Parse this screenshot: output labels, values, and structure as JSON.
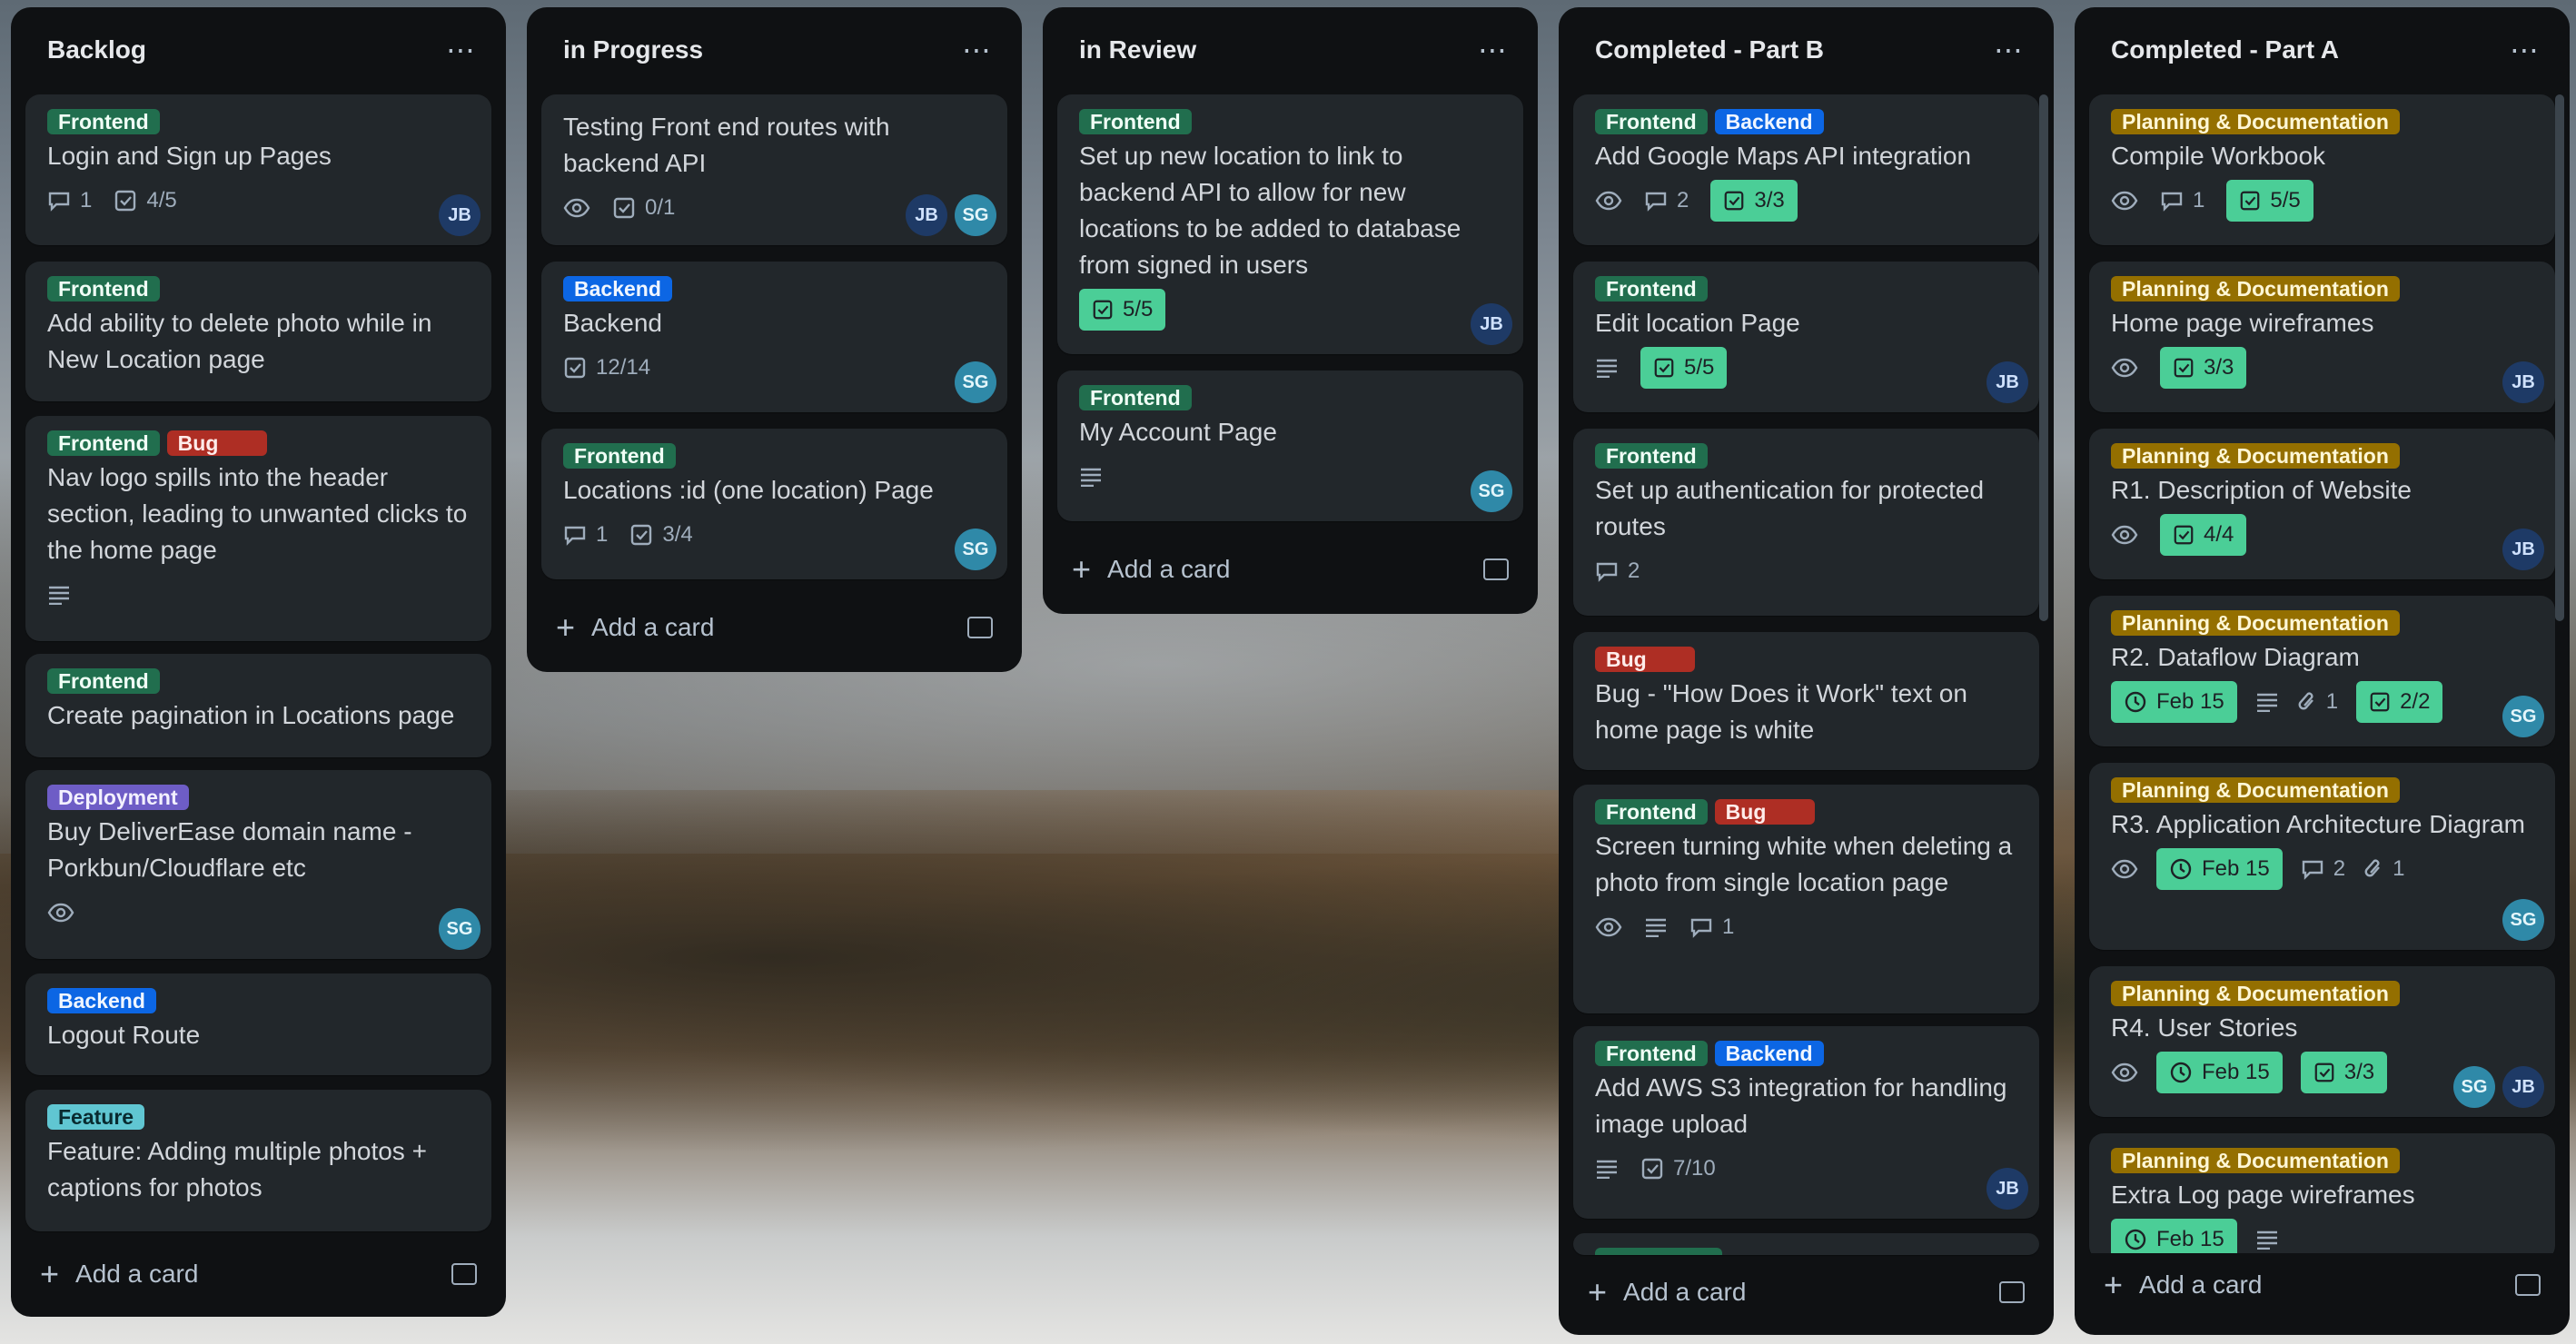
{
  "board": {
    "add_card_label": "Add a card",
    "lists": [
      {
        "title": "Backlog",
        "cards": [
          {
            "labels": [
              "Frontend"
            ],
            "title": "Login and Sign up Pages",
            "comments": "1",
            "checklist": "4/5",
            "members": [
              "JB"
            ]
          },
          {
            "labels": [
              "Frontend"
            ],
            "title": "Add ability to delete photo while in New Location page"
          },
          {
            "labels": [
              "Frontend",
              "Bug"
            ],
            "title": "Nav logo spills into the header section, leading to unwanted clicks to the home page"
          },
          {
            "labels": [
              "Frontend"
            ],
            "title": "Create pagination in Locations page"
          },
          {
            "labels": [
              "Deployment"
            ],
            "title": "Buy DeliverEase domain name - Porkbun/Cloudflare etc",
            "members": [
              "SG"
            ]
          },
          {
            "labels": [
              "Backend"
            ],
            "title": "Logout Route"
          },
          {
            "labels": [
              "Feature"
            ],
            "title": "Feature: Adding multiple photos + captions for photos"
          }
        ]
      },
      {
        "title": "in Progress",
        "cards": [
          {
            "title": "Testing Front end routes with backend API",
            "checklist": "0/1",
            "members": [
              "JB",
              "SG"
            ]
          },
          {
            "labels": [
              "Backend"
            ],
            "title": "Backend",
            "checklist": "12/14",
            "members": [
              "SG"
            ]
          },
          {
            "labels": [
              "Frontend"
            ],
            "title": "Locations :id (one location) Page",
            "comments": "1",
            "checklist": "3/4",
            "members": [
              "SG"
            ]
          }
        ]
      },
      {
        "title": "in Review",
        "cards": [
          {
            "labels": [
              "Frontend"
            ],
            "title": "Set up new location to link to backend API to allow for new locations to be added to database from signed in users",
            "checklist": "5/5",
            "members": [
              "JB"
            ]
          },
          {
            "labels": [
              "Frontend"
            ],
            "title": "My Account Page",
            "members": [
              "SG"
            ]
          }
        ]
      },
      {
        "title": "Completed - Part B",
        "cards": [
          {
            "labels": [
              "Frontend",
              "Backend"
            ],
            "title": "Add Google Maps API integration",
            "comments": "2",
            "checklist": "3/3"
          },
          {
            "labels": [
              "Frontend"
            ],
            "title": "Edit location Page",
            "checklist": "5/5",
            "members": [
              "JB"
            ]
          },
          {
            "labels": [
              "Frontend"
            ],
            "title": "Set up authentication for protected routes",
            "comments": "2"
          },
          {
            "labels": [
              "Bug"
            ],
            "title": "Bug - \"How Does it Work\" text on home page is white"
          },
          {
            "labels": [
              "Frontend",
              "Bug"
            ],
            "title": "Screen turning white when deleting a photo from single location page",
            "comments": "1"
          },
          {
            "labels": [
              "Frontend",
              "Backend"
            ],
            "title": "Add AWS S3 integration for handling image upload",
            "checklist": "7/10",
            "members": [
              "JB"
            ]
          }
        ]
      },
      {
        "title": "Completed - Part A",
        "cards": [
          {
            "labels": [
              "Planning & Documentation"
            ],
            "title": "Compile Workbook",
            "comments": "1",
            "checklist": "5/5"
          },
          {
            "labels": [
              "Planning & Documentation"
            ],
            "title": "Home page wireframes",
            "checklist": "3/3",
            "members": [
              "JB"
            ]
          },
          {
            "labels": [
              "Planning & Documentation"
            ],
            "title": "R1. Description of Website",
            "checklist": "4/4",
            "members": [
              "JB"
            ]
          },
          {
            "labels": [
              "Planning & Documentation"
            ],
            "title": "R2. Dataflow Diagram",
            "date": "Feb 15",
            "attachments": "1",
            "checklist": "2/2",
            "members": [
              "SG"
            ]
          },
          {
            "labels": [
              "Planning & Documentation"
            ],
            "title": "R3. Application Architecture Diagram",
            "date": "Feb 15",
            "comments": "2",
            "attachments": "1",
            "members": [
              "SG"
            ]
          },
          {
            "labels": [
              "Planning & Documentation"
            ],
            "title": "R4. User Stories",
            "date": "Feb 15",
            "checklist": "3/3",
            "members": [
              "SG",
              "JB"
            ]
          },
          {
            "labels": [
              "Planning & Documentation"
            ],
            "title": "Extra Log page wireframes",
            "date": "Feb 15"
          }
        ]
      }
    ]
  },
  "icons": {
    "menu": "ellipsis-icon",
    "comment": "comment-icon",
    "checklist": "checklist-icon",
    "watch": "eye-icon",
    "description": "description-icon",
    "clock": "clock-icon",
    "attachment": "paperclip-icon",
    "template": "card-template-icon",
    "add": "plus-icon"
  },
  "colors": {
    "list_bg": "#0f1113",
    "card_bg": "#22272b",
    "frontend": "#216e4e",
    "backend": "#0c66e4",
    "bug": "#ae2e24",
    "deployment": "#6e5dc6",
    "feature": "#60c6d2",
    "planning": "#946f00",
    "complete": "#4bce97"
  }
}
